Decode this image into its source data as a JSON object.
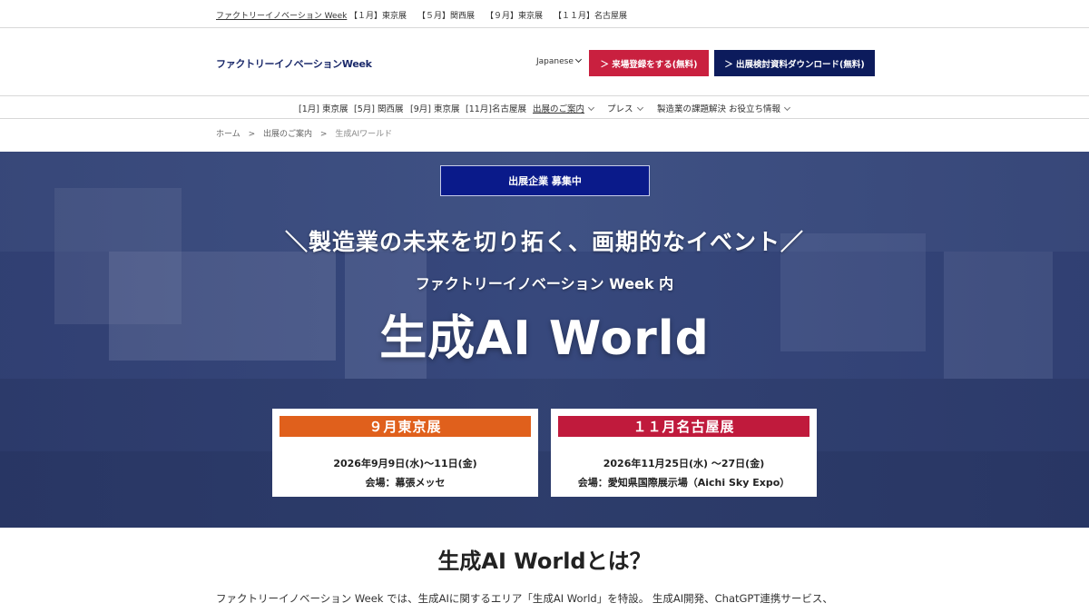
{
  "topbar": {
    "links": [
      "ファクトリーイノベーション Week",
      "【１月】東京展",
      "【５月】関西展",
      "【９月】東京展",
      "【１１月】名古屋展"
    ]
  },
  "header": {
    "logo": "ファクトリーイノベーションWeek",
    "language": "Japanese",
    "register_button": "＞ 来場登録をする(無料)",
    "download_button": "＞ 出展検討資料ダウンロード(無料)"
  },
  "nav": {
    "items": [
      "[1月] 東京展",
      "[5月] 関西展",
      "[9月] 東京展",
      "[11月]名古屋展",
      "出展のご案内",
      "プレス",
      "製造業の課題解決 お役立ち情報"
    ]
  },
  "breadcrumb": {
    "items": [
      "ホーム",
      ">",
      "出展のご案内",
      ">",
      "生成AIワールド"
    ]
  },
  "hero": {
    "recruit_button": "出展企業 募集中",
    "tagline": "＼製造業の未来を切り拓く、画期的なイベント／",
    "within": "ファクトリーイノベーション Week 内",
    "title": "生成AI World",
    "cards": [
      {
        "label": "９月東京展",
        "date": "2026年9月9日(水)～11日(金)",
        "venue": "会場：幕張メッセ",
        "color": "#e0601c"
      },
      {
        "label": "１１月名古屋展",
        "date": "2026年11月25日(水) ～27日(金)",
        "venue": "会場：愛知県国際展示場（Aichi Sky Expo）",
        "color": "#c01a3c"
      }
    ]
  },
  "about": {
    "title": "生成AI Worldとは？",
    "text": "ファクトリーイノベーション Week では、生成AIに関するエリア「生成AI World」を特設。 生成AI開発、ChatGPT連携サービス、"
  },
  "colors": {
    "navy": "#0c1b5c",
    "red": "#c9203f",
    "orange": "#e0601c"
  }
}
